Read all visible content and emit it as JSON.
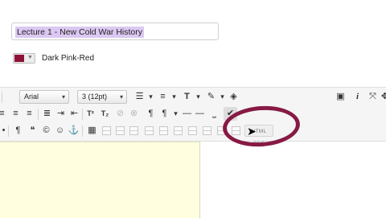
{
  "title_field": {
    "value": "Lecture 1 - New Cold War History"
  },
  "color_picker": {
    "label": "Dark Pink-Red",
    "color": "#8e1238"
  },
  "toolbar": {
    "font_family": "Arial",
    "font_size": "3 (12pt)",
    "html_css_label": "HTML CSS",
    "icons": [
      "bullet-list",
      "numbered-list",
      "text-style",
      "highlighter",
      "eraser",
      "preview",
      "info",
      "fullscreen",
      "arrows",
      "bold",
      "strike",
      "superscript",
      "subscript",
      "link",
      "unlink",
      "paragraph-mark",
      "hr",
      "anchor",
      "table",
      "html-css"
    ]
  },
  "accent": {
    "ring": "#861a45",
    "editor_bg": "#ffffdf"
  }
}
